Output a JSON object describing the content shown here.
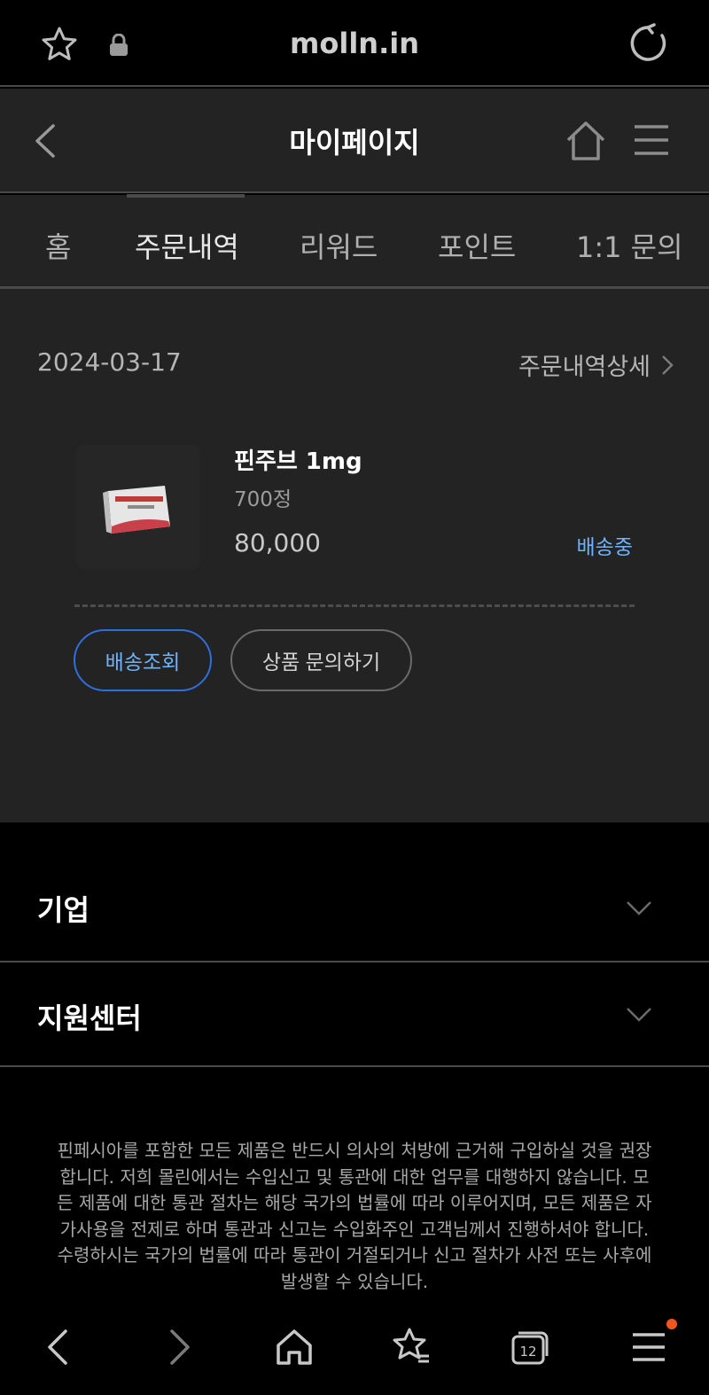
{
  "browser": {
    "url": "molln.in",
    "tab_count": "12"
  },
  "header": {
    "title": "마이페이지"
  },
  "tabs": [
    {
      "label": "홈"
    },
    {
      "label": "주문내역"
    },
    {
      "label": "리워드"
    },
    {
      "label": "포인트"
    },
    {
      "label": "1:1 문의"
    }
  ],
  "active_tab": "주문내역",
  "order": {
    "date": "2024-03-17",
    "detail_link": "주문내역상세",
    "product": {
      "name": "핀주브 1mg",
      "quantity": "700정",
      "price": "80,000",
      "status": "배송중"
    },
    "buttons": {
      "track": "배송조회",
      "inquiry": "상품 문의하기"
    }
  },
  "footer": {
    "sections": [
      {
        "label": "기업"
      },
      {
        "label": "지원센터"
      }
    ],
    "disclaimer_lines": [
      "핀페시아를 포함한 모든 제품은 반드시 의사의 처방에 근거해 구입하실 것을 권장",
      "합니다. 저희 몰린에서는 수입신고 및 통관에 대한 업무를 대행하지 않습니다. 모",
      "든 제품에 대한 통관 절차는 해당 국가의 법률에 따라 이루어지며, 모든 제품은 자",
      "가사용을 전제로 하며 통관과 신고는 수입화주인 고객님께서 진행하셔야 합니다.",
      "수령하시는 국가의 법률에 따라 통관이 거절되거나 신고 절차가 사전 또는 사후에",
      "발생할 수 있습니다."
    ]
  },
  "colors": {
    "accent_blue": "#6fb3ff",
    "badge_orange": "#f0571f"
  }
}
